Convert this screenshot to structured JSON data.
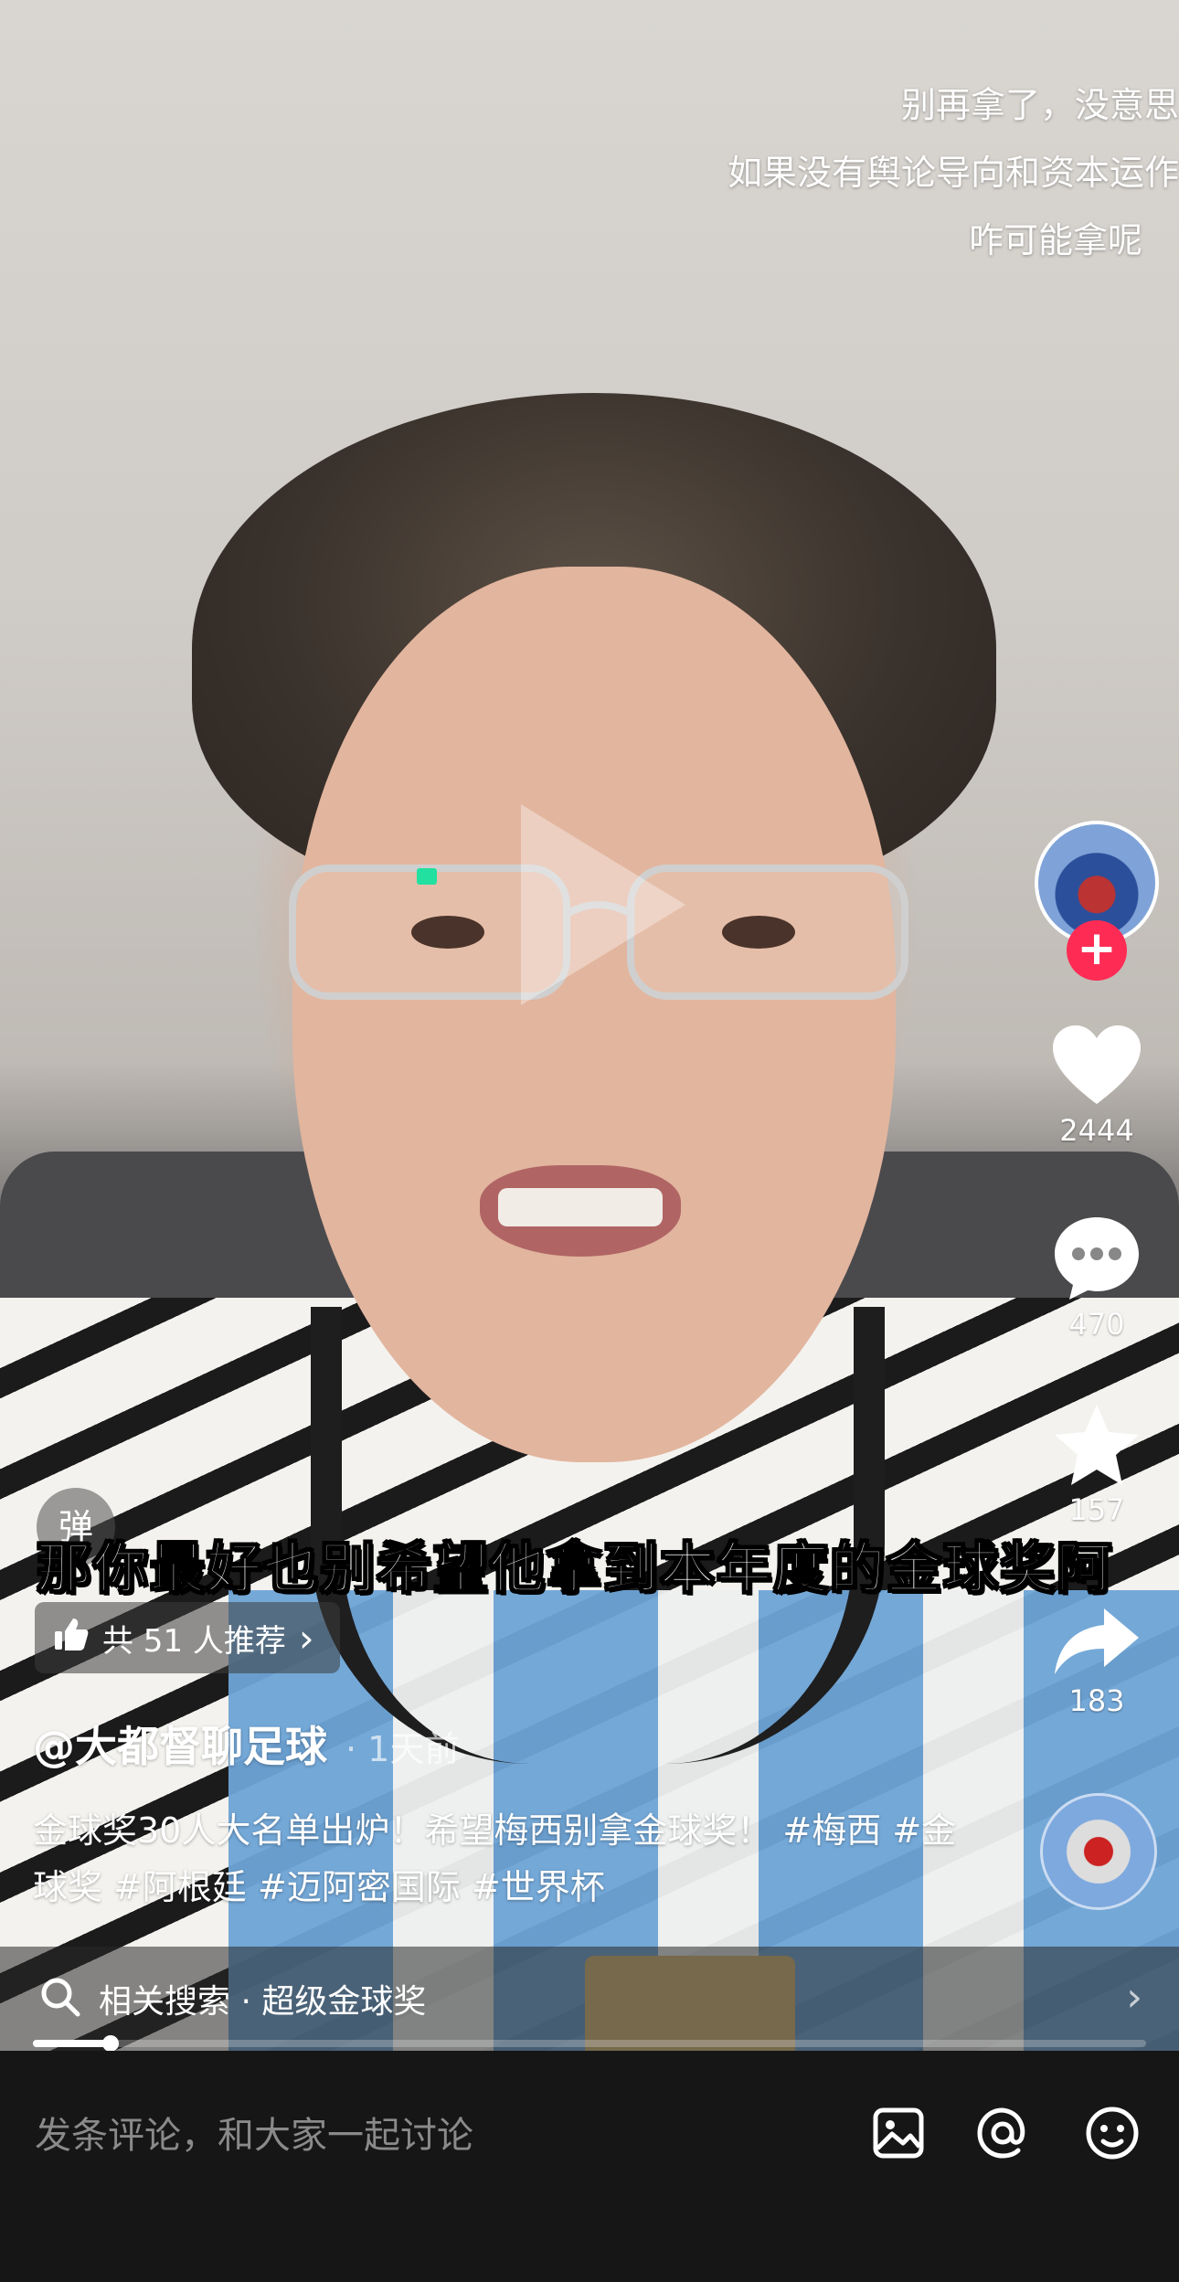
{
  "top_captions": [
    "别再拿了，没意思",
    "如果没有舆论导向和资本运作",
    "咋可能拿呢"
  ],
  "subtitle": "那你最好也别希望他拿到本年度的金球奖阿",
  "danmu_label": "弹",
  "actions": {
    "like_count": "2444",
    "comment_count": "470",
    "favorite_count": "157",
    "share_count": "183"
  },
  "recommend": {
    "label": "共 51 人推荐",
    "chevron": "›"
  },
  "author": {
    "name": "@大都督聊足球",
    "time": "· 1天前"
  },
  "description": "金球奖30人大名单出炉！希望梅西别拿金球奖！ #梅西 #金球奖 #阿根廷 #迈阿密国际 #世界杯",
  "related_search": {
    "text": "相关搜索 · 超级金球奖",
    "chevron": "›"
  },
  "progress": 0.07,
  "comment_bar": {
    "placeholder": "发条评论，和大家一起讨论"
  },
  "icons": [
    "follow-plus-icon",
    "heart-icon",
    "comment-icon",
    "star-icon",
    "share-icon",
    "thumbs-up-icon",
    "search-icon",
    "image-icon",
    "at-icon",
    "emoji-icon",
    "play-icon"
  ],
  "colors": {
    "accent": "#fe2c55",
    "bottom_bar": "#161616"
  }
}
